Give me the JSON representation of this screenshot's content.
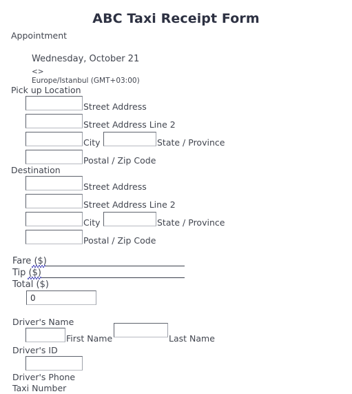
{
  "form": {
    "title": "ABC Taxi Receipt Form"
  },
  "appointment": {
    "label": "Appointment",
    "date_text": "Wednesday, October 21",
    "time_text": "<>",
    "timezone_text": "Europe/Istanbul (GMT+03:00)"
  },
  "pickup": {
    "label": "Pick up Location",
    "street_address": {
      "value": "",
      "sub_label": "Street Address"
    },
    "street_address_2": {
      "value": "",
      "sub_label": "Street Address Line 2"
    },
    "city": {
      "value": "",
      "sub_label": "City"
    },
    "state": {
      "value": "",
      "sub_label": "State / Province"
    },
    "postal": {
      "value": "",
      "sub_label": "Postal / Zip Code"
    }
  },
  "destination": {
    "label": "Destination",
    "street_address": {
      "value": "",
      "sub_label": "Street Address"
    },
    "street_address_2": {
      "value": "",
      "sub_label": "Street Address Line 2"
    },
    "city": {
      "value": "",
      "sub_label": "City"
    },
    "state": {
      "value": "",
      "sub_label": "State / Province"
    },
    "postal": {
      "value": "",
      "sub_label": "Postal / Zip Code"
    }
  },
  "amounts": {
    "fare_label": "Fare ($)",
    "tip_label": "Tip ($)",
    "total_label": "Total ($)",
    "total_value": "0"
  },
  "driver": {
    "name_label": "Driver's Name",
    "first_name": {
      "value": "",
      "sub_label": "First Name"
    },
    "last_name": {
      "value": "",
      "sub_label": "Last Name"
    },
    "id_label": "Driver's ID",
    "id_value": "",
    "phone_label": "Driver's Phone",
    "taxi_number_label": "Taxi Number"
  },
  "colors": {
    "title": "#2d3142",
    "text": "#41454f",
    "field_border": "#5d626c",
    "spellcheck_squiggle": "#4a4ab8"
  }
}
